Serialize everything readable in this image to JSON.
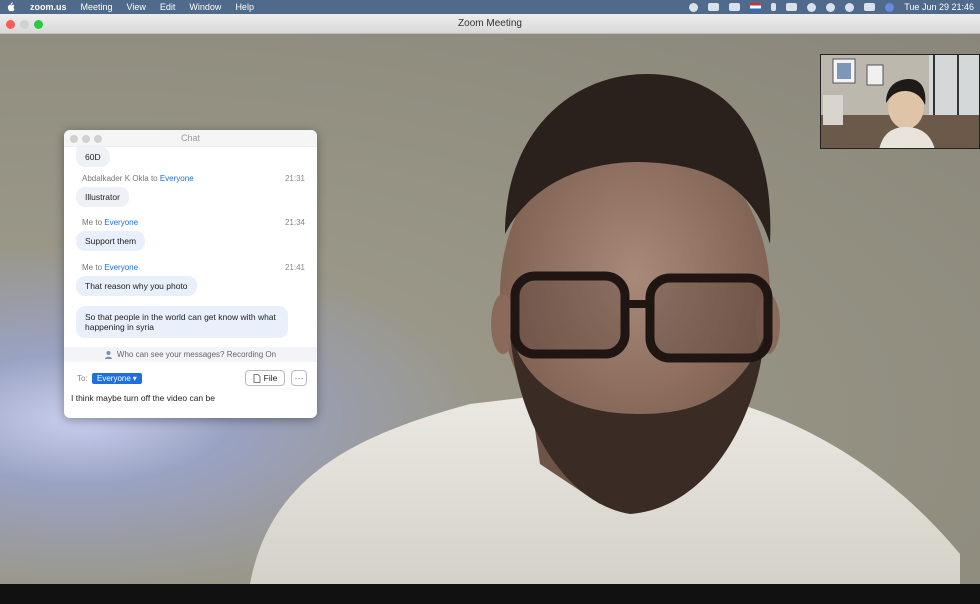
{
  "menubar": {
    "app_name": "zoom.us",
    "items": [
      "Meeting",
      "View",
      "Edit",
      "Window",
      "Help"
    ],
    "clock": "Tue Jun 29  21:46"
  },
  "window": {
    "title": "Zoom Meeting"
  },
  "chat": {
    "title": "Chat",
    "messages": [
      {
        "text": "60D"
      },
      {
        "sender": "Abdalkader K Okla",
        "to_word": "to",
        "recipient": "Everyone",
        "time": "21:31",
        "text": "Illustrator"
      },
      {
        "sender": "Me",
        "to_word": "to",
        "recipient": "Everyone",
        "time": "21:34",
        "text": "Support them"
      },
      {
        "sender": "Me",
        "to_word": "to",
        "recipient": "Everyone",
        "time": "21:41",
        "text": "That reason why you photo"
      },
      {
        "text": "So that people in the world can get know with what happening in syria"
      }
    ],
    "notice": "Who can see your messages? Recording On",
    "to_label": "To:",
    "recipient_select": "Everyone",
    "file_button": "File",
    "more_button": "···",
    "compose_value": "I think maybe turn off the video can be"
  },
  "colors": {
    "accent": "#1f6fe0",
    "menubar": "#4f6a8a"
  }
}
